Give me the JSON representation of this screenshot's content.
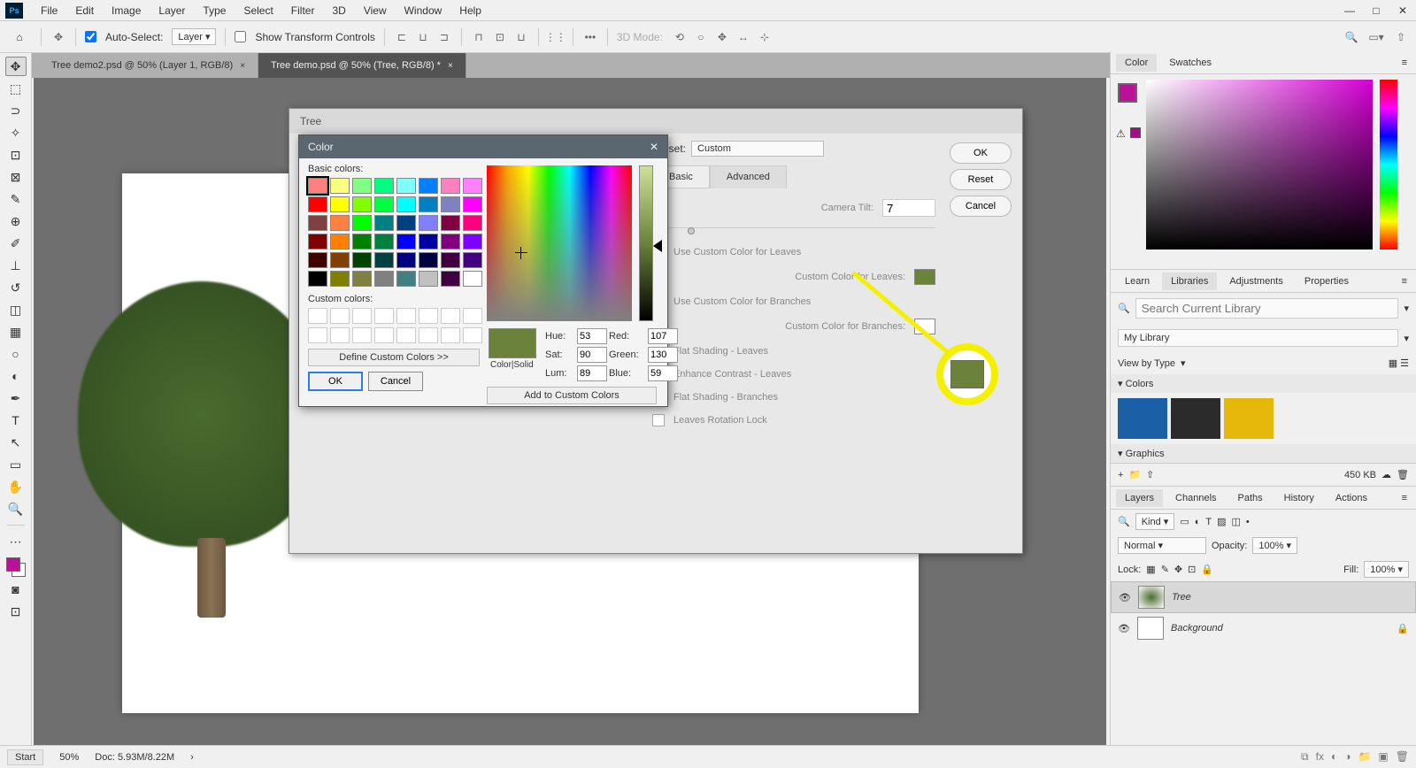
{
  "menu": [
    "File",
    "Edit",
    "Image",
    "Layer",
    "Type",
    "Select",
    "Filter",
    "3D",
    "View",
    "Window",
    "Help"
  ],
  "opt": {
    "autoselect": "Auto-Select:",
    "layer": "Layer",
    "stc": "Show Transform Controls",
    "mode3d": "3D Mode:"
  },
  "tabs": [
    {
      "t": "Tree demo2.psd @ 50% (Layer 1, RGB/8)",
      "active": false
    },
    {
      "t": "Tree demo.psd @ 50% (Tree, RGB/8) *",
      "active": true
    }
  ],
  "tree": {
    "title": "Tree",
    "presetLbl": "Preset:",
    "preset": "Custom",
    "tabs": [
      "Basic",
      "Advanced"
    ],
    "camTilt": "Camera Tilt:",
    "camTiltVal": "7",
    "uccl": "Use Custom Color for Leaves",
    "ccl": "Custom Color for Leaves:",
    "uccb": "Use Custom Color for Branches",
    "ccb": "Custom Color for Branches:",
    "fsl": "Flat Shading - Leaves",
    "ecl": "Enhance Contrast - Leaves",
    "fsb": "Flat Shading - Branches",
    "lrl": "Leaves Rotation Lock",
    "ok": "OK",
    "reset": "Reset",
    "cancel": "Cancel"
  },
  "color": {
    "title": "Color",
    "basic": "Basic colors:",
    "custom": "Custom colors:",
    "define": "Define Custom Colors >>",
    "ok": "OK",
    "cancel": "Cancel",
    "colorsolid": "Color|Solid",
    "add": "Add to Custom Colors",
    "hue": "Hue:",
    "sat": "Sat:",
    "lum": "Lum:",
    "red": "Red:",
    "green": "Green:",
    "blue": "Blue:",
    "h": "53",
    "s": "90",
    "l": "89",
    "r": "107",
    "g": "130",
    "b": "59",
    "palette": [
      "#ff8080",
      "#ffff80",
      "#80ff80",
      "#00ff80",
      "#80ffff",
      "#0080ff",
      "#ff80c0",
      "#ff80ff",
      "#ff0000",
      "#ffff00",
      "#80ff00",
      "#00ff40",
      "#00ffff",
      "#0080c0",
      "#8080c0",
      "#ff00ff",
      "#804040",
      "#ff8040",
      "#00ff00",
      "#008080",
      "#004080",
      "#8080ff",
      "#800040",
      "#ff0080",
      "#800000",
      "#ff8000",
      "#008000",
      "#008040",
      "#0000ff",
      "#0000a0",
      "#800080",
      "#8000ff",
      "#400000",
      "#804000",
      "#004000",
      "#004040",
      "#000080",
      "#000040",
      "#400040",
      "#400080",
      "#000000",
      "#808000",
      "#808040",
      "#808080",
      "#408080",
      "#c0c0c0",
      "#400040",
      "#ffffff"
    ]
  },
  "panels": {
    "color": [
      "Color",
      "Swatches"
    ],
    "lib": [
      "Learn",
      "Libraries",
      "Adjustments",
      "Properties"
    ],
    "search": "Search Current Library",
    "mylib": "My Library",
    "view": "View by Type",
    "colorsHdr": "Colors",
    "graphicsHdr": "Graphics",
    "kb": "450 KB",
    "layers": [
      "Layers",
      "Channels",
      "Paths",
      "History",
      "Actions"
    ],
    "kind": "Kind",
    "normal": "Normal",
    "opacity": "Opacity:",
    "op100": "100%",
    "lock": "Lock:",
    "fill": "Fill:",
    "fill100": "100%",
    "layer1": "Tree",
    "layer2": "Background"
  },
  "status": {
    "start": "Start",
    "zoom": "50%",
    "doc": "Doc: 5.93M/8.22M"
  }
}
